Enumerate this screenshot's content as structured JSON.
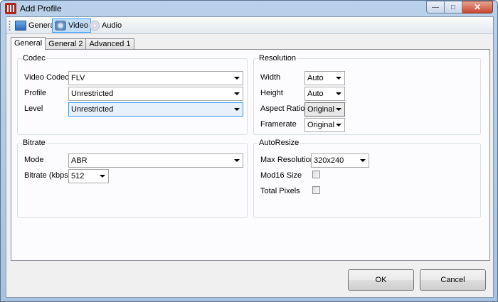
{
  "window": {
    "title": "Add Profile"
  },
  "toolbar": {
    "items": [
      {
        "label": "General",
        "icon": "general-icon"
      },
      {
        "label": "Video",
        "icon": "video-icon",
        "active": true
      },
      {
        "label": "Audio",
        "icon": "audio-icon"
      }
    ]
  },
  "tabs": [
    {
      "label": "General",
      "active": true
    },
    {
      "label": "General 2"
    },
    {
      "label": "Advanced 1"
    }
  ],
  "codec": {
    "title": "Codec",
    "video_codec_label": "Video Codec",
    "video_codec_value": "FLV",
    "profile_label": "Profile",
    "profile_value": "Unrestricted",
    "level_label": "Level",
    "level_value": "Unrestricted"
  },
  "resolution": {
    "title": "Resolution",
    "width_label": "Width",
    "width_value": "Auto",
    "height_label": "Height",
    "height_value": "Auto",
    "aspect_label": "Aspect Ratio",
    "aspect_value": "Original",
    "framerate_label": "Framerate",
    "framerate_value": "Original"
  },
  "bitrate": {
    "title": "Bitrate",
    "mode_label": "Mode",
    "mode_value": "ABR",
    "kbps_label": "Bitrate (kbps)",
    "kbps_value": "512"
  },
  "autoresize": {
    "title": "AutoResize",
    "max_res_label": "Max Resolution",
    "max_res_value": "320x240",
    "mod16_label": "Mod16 Size",
    "mod16_checked": false,
    "total_pixels_label": "Total Pixels",
    "total_pixels_checked": false
  },
  "buttons": {
    "ok": "OK",
    "cancel": "Cancel"
  },
  "colors": {
    "accent": "#3399ff",
    "active_toolbar": "#c2dcf5",
    "focused_combo": "#e7f1fb"
  }
}
